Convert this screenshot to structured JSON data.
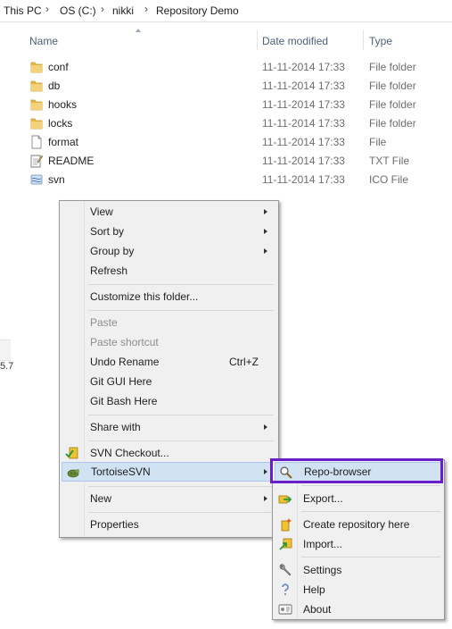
{
  "breadcrumb": {
    "items": [
      "This PC",
      "OS (C:)",
      "nikki",
      "Repository Demo"
    ],
    "separator": "›"
  },
  "columns": {
    "name": "Name",
    "date": "Date modified",
    "type": "Type"
  },
  "files": [
    {
      "name": "conf",
      "date": "11-11-2014 17:33",
      "type": "File folder",
      "icon": "folder-icon"
    },
    {
      "name": "db",
      "date": "11-11-2014 17:33",
      "type": "File folder",
      "icon": "folder-icon"
    },
    {
      "name": "hooks",
      "date": "11-11-2014 17:33",
      "type": "File folder",
      "icon": "folder-icon"
    },
    {
      "name": "locks",
      "date": "11-11-2014 17:33",
      "type": "File folder",
      "icon": "folder-icon"
    },
    {
      "name": "format",
      "date": "11-11-2014 17:33",
      "type": "File",
      "icon": "file-icon"
    },
    {
      "name": "README",
      "date": "11-11-2014 17:33",
      "type": "TXT File",
      "icon": "text-file-icon"
    },
    {
      "name": "svn",
      "date": "11-11-2014 17:33",
      "type": "ICO File",
      "icon": "ico-file-icon"
    }
  ],
  "left_pane": {
    "partial_text": "5.7"
  },
  "context_menu": {
    "view": "View",
    "sort_by": "Sort by",
    "group_by": "Group by",
    "refresh": "Refresh",
    "customize": "Customize this folder...",
    "paste": "Paste",
    "paste_shortcut": "Paste shortcut",
    "undo_rename": "Undo Rename",
    "undo_rename_shortcut": "Ctrl+Z",
    "git_gui": "Git GUI Here",
    "git_bash": "Git Bash Here",
    "share_with": "Share with",
    "svn_checkout": "SVN Checkout...",
    "tortoisesvn": "TortoiseSVN",
    "new": "New",
    "properties": "Properties"
  },
  "submenu": {
    "repo_browser": "Repo-browser",
    "export": "Export...",
    "create_repo": "Create repository here",
    "import": "Import...",
    "settings": "Settings",
    "help": "Help",
    "about": "About"
  },
  "colors": {
    "highlight_border": "#6a1fc9",
    "hover_bg": "#d1e2f2",
    "folder": "#e8b94a",
    "header_text": "#4c607a"
  }
}
